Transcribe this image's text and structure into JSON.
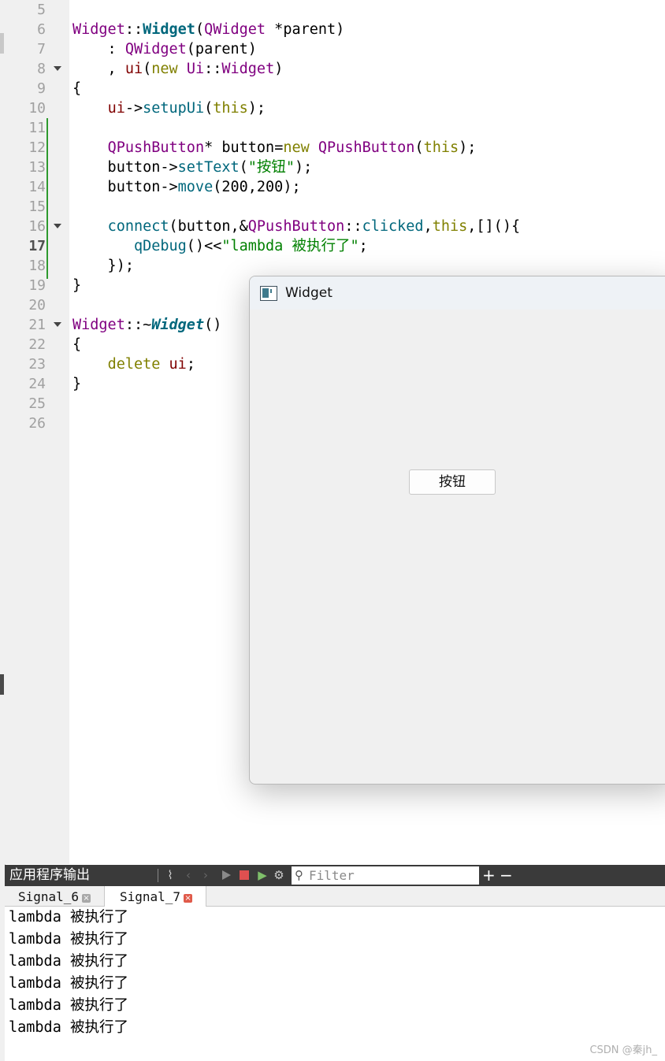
{
  "editor": {
    "lines": [
      {
        "num": "5",
        "segs": []
      },
      {
        "num": "6",
        "segs": [
          {
            "c": "t",
            "x": "Widget"
          },
          {
            "c": "",
            "x": "::"
          },
          {
            "c": "fb",
            "x": "Widget"
          },
          {
            "c": "",
            "x": "("
          },
          {
            "c": "t",
            "x": "QWidget"
          },
          {
            "c": "",
            "x": " *"
          },
          {
            "c": "",
            "x": "parent"
          },
          {
            "c": "",
            "x": ")"
          }
        ]
      },
      {
        "num": "7",
        "segs": [
          {
            "c": "",
            "x": "    : "
          },
          {
            "c": "t",
            "x": "QWidget"
          },
          {
            "c": "",
            "x": "(parent)"
          }
        ]
      },
      {
        "num": "8",
        "fold": true,
        "segs": [
          {
            "c": "",
            "x": "    , "
          },
          {
            "c": "m",
            "x": "ui"
          },
          {
            "c": "",
            "x": "("
          },
          {
            "c": "k",
            "x": "new"
          },
          {
            "c": "",
            "x": " "
          },
          {
            "c": "t",
            "x": "Ui"
          },
          {
            "c": "",
            "x": "::"
          },
          {
            "c": "t",
            "x": "Widget"
          },
          {
            "c": "",
            "x": ")"
          }
        ]
      },
      {
        "num": "9",
        "segs": [
          {
            "c": "",
            "x": "{"
          }
        ]
      },
      {
        "num": "10",
        "segs": [
          {
            "c": "",
            "x": "    "
          },
          {
            "c": "m",
            "x": "ui"
          },
          {
            "c": "",
            "x": "->"
          },
          {
            "c": "f",
            "x": "setupUi"
          },
          {
            "c": "",
            "x": "("
          },
          {
            "c": "k",
            "x": "this"
          },
          {
            "c": "",
            "x": ");"
          }
        ]
      },
      {
        "num": "11",
        "segs": []
      },
      {
        "num": "12",
        "segs": [
          {
            "c": "",
            "x": "    "
          },
          {
            "c": "t",
            "x": "QPushButton"
          },
          {
            "c": "",
            "x": "* button="
          },
          {
            "c": "k",
            "x": "new"
          },
          {
            "c": "",
            "x": " "
          },
          {
            "c": "t",
            "x": "QPushButton"
          },
          {
            "c": "",
            "x": "("
          },
          {
            "c": "k",
            "x": "this"
          },
          {
            "c": "",
            "x": ");"
          }
        ]
      },
      {
        "num": "13",
        "segs": [
          {
            "c": "",
            "x": "    button->"
          },
          {
            "c": "f",
            "x": "setText"
          },
          {
            "c": "",
            "x": "("
          },
          {
            "c": "s",
            "x": "\"按钮\""
          },
          {
            "c": "",
            "x": ");"
          }
        ]
      },
      {
        "num": "14",
        "segs": [
          {
            "c": "",
            "x": "    button->"
          },
          {
            "c": "f",
            "x": "move"
          },
          {
            "c": "",
            "x": "(200,200);"
          }
        ]
      },
      {
        "num": "15",
        "segs": []
      },
      {
        "num": "16",
        "fold": true,
        "segs": [
          {
            "c": "",
            "x": "    "
          },
          {
            "c": "f",
            "x": "connect"
          },
          {
            "c": "",
            "x": "(button,&"
          },
          {
            "c": "t",
            "x": "QPushButton"
          },
          {
            "c": "",
            "x": "::"
          },
          {
            "c": "f",
            "x": "clicked"
          },
          {
            "c": "",
            "x": ","
          },
          {
            "c": "k",
            "x": "this"
          },
          {
            "c": "",
            "x": ",[](){"
          }
        ]
      },
      {
        "num": "17",
        "current": true,
        "segs": [
          {
            "c": "",
            "x": "       "
          },
          {
            "c": "f",
            "x": "qDebug"
          },
          {
            "c": "",
            "x": "()<<"
          },
          {
            "c": "s",
            "x": "\"lambda 被执行了\""
          },
          {
            "c": "",
            "x": ";"
          }
        ]
      },
      {
        "num": "18",
        "segs": [
          {
            "c": "",
            "x": "    });"
          }
        ]
      },
      {
        "num": "19",
        "segs": [
          {
            "c": "",
            "x": "}"
          }
        ]
      },
      {
        "num": "20",
        "segs": []
      },
      {
        "num": "21",
        "fold": true,
        "segs": [
          {
            "c": "t",
            "x": "Widget"
          },
          {
            "c": "",
            "x": "::~"
          },
          {
            "c": "fbi",
            "x": "Widget"
          },
          {
            "c": "",
            "x": "()"
          }
        ]
      },
      {
        "num": "22",
        "segs": [
          {
            "c": "",
            "x": "{"
          }
        ]
      },
      {
        "num": "23",
        "segs": [
          {
            "c": "",
            "x": "    "
          },
          {
            "c": "k",
            "x": "delete"
          },
          {
            "c": "",
            "x": " "
          },
          {
            "c": "m",
            "x": "ui"
          },
          {
            "c": "",
            "x": ";"
          }
        ]
      },
      {
        "num": "24",
        "segs": [
          {
            "c": "",
            "x": "}"
          }
        ]
      },
      {
        "num": "25",
        "segs": []
      },
      {
        "num": "26",
        "segs": []
      }
    ]
  },
  "widget_window": {
    "title": "Widget",
    "button_label": "按钮"
  },
  "output_pane": {
    "title": "应用程序输出",
    "filter_placeholder": "Filter",
    "plus_label": "+",
    "minus_label": "−",
    "tabs": [
      {
        "label": "Signal_6",
        "active": false
      },
      {
        "label": "Signal_7",
        "active": true
      }
    ],
    "lines": [
      "lambda 被执行了",
      "lambda 被执行了",
      "lambda 被执行了",
      "lambda 被执行了",
      "lambda 被执行了",
      "lambda 被执行了"
    ]
  },
  "watermark": "CSDN @秦jh_"
}
